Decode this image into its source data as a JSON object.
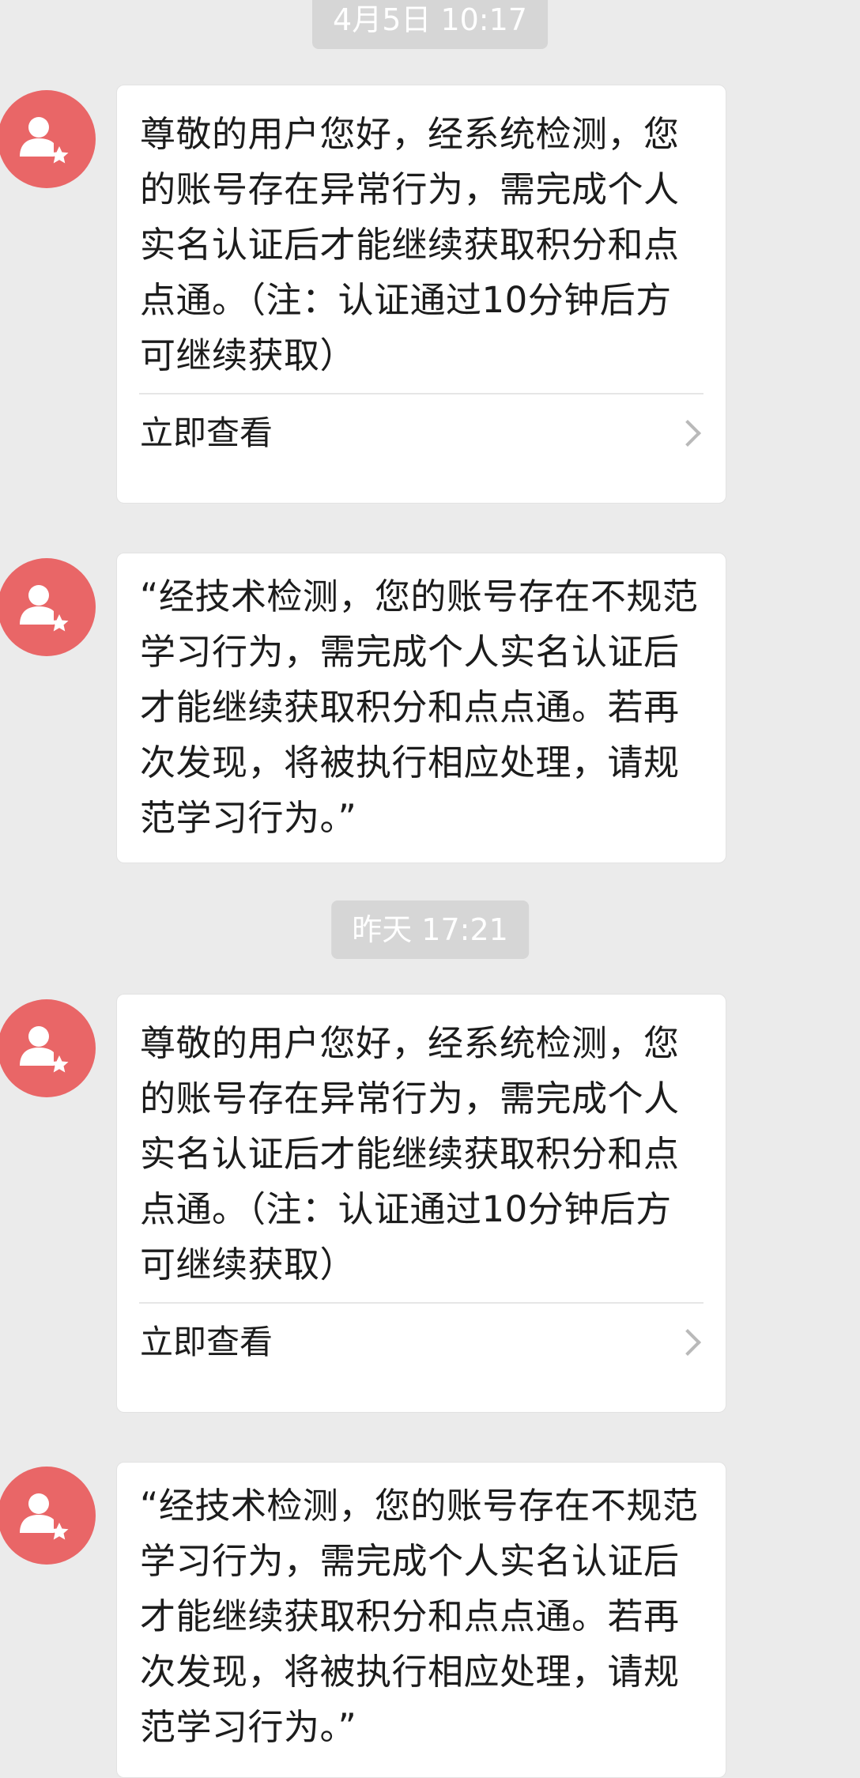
{
  "timestamps": [
    "4月5日  10:17",
    "昨天  17:21"
  ],
  "messages": [
    {
      "text": "尊敬的用户您好，经系统检测，您的账号存在异常行为，需完成个人实名认证后才能继续获取积分和点点通。（注：认证通过10分钟后方可继续获取）",
      "action": "立即查看"
    },
    {
      "text": "“经技术检测，您的账号存在不规范学习行为，需完成个人实名认证后才能继续获取积分和点点通。若再次发现，将被执行相应处理，请规范学习行为。”"
    },
    {
      "text": "尊敬的用户您好，经系统检测，您的账号存在异常行为，需完成个人实名认证后才能继续获取积分和点点通。（注：认证通过10分钟后方可继续获取）",
      "action": "立即查看"
    },
    {
      "text": "“经技术检测，您的账号存在不规范学习行为，需完成个人实名认证后才能继续获取积分和点点通。若再次发现，将被执行相应处理，请规范学习行为。”"
    }
  ],
  "icons": {
    "avatar": "user-star-icon",
    "chevron": "chevron-right-icon"
  },
  "colors": {
    "avatar_bg": "#e96667",
    "page_bg": "#ebebeb",
    "bubble_bg": "#ffffff",
    "timestamp_bg": "#d6d6d6"
  }
}
